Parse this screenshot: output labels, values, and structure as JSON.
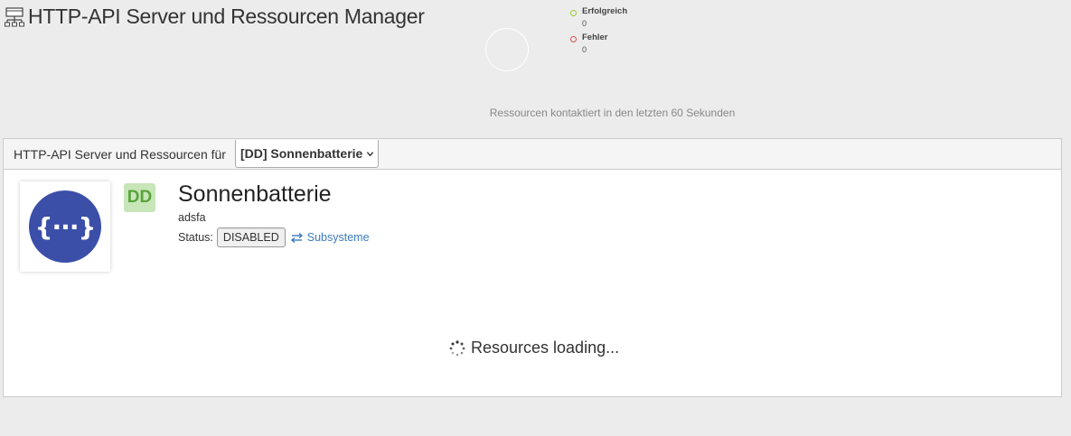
{
  "header": {
    "title": "HTTP-API Server und Ressourcen Manager",
    "icon": "network-icon"
  },
  "stats": {
    "success_label": "Erfolgreich",
    "success_count": "0",
    "error_label": "Fehler",
    "error_count": "0",
    "caption": "Ressourcen kontaktiert in den letzten 60 Sekunden",
    "colors": {
      "success": "#9acd32",
      "error": "#d9534f"
    }
  },
  "panel": {
    "for_label": "HTTP-API Server und Ressourcen für",
    "selected_server": "[DD] Sonnenbatterie"
  },
  "server": {
    "logo_glyph": "{···}",
    "badge": "DD",
    "name": "Sonnenbatterie",
    "description": "adsfa",
    "status_label": "Status:",
    "status_value": "DISABLED",
    "subsystems_label": "Subsysteme"
  },
  "loading_text": "Resources loading...",
  "colors": {
    "logo_bg": "#3b4fa9",
    "badge_bg": "#c8e6b9",
    "badge_fg": "#5aa33b",
    "link": "#3a7bbf"
  }
}
